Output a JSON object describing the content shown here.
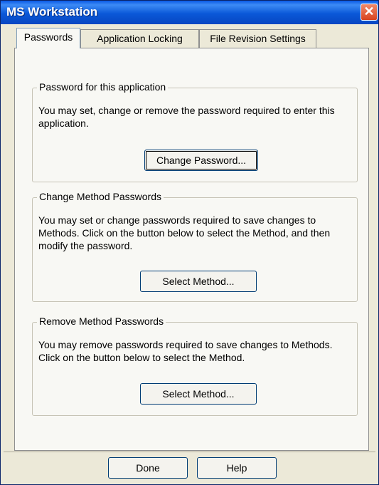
{
  "window": {
    "title": "MS Workstation"
  },
  "tabs": [
    {
      "label": "Passwords"
    },
    {
      "label": "Application Locking"
    },
    {
      "label": "File Revision Settings"
    }
  ],
  "groups": [
    {
      "title": "Password for this application",
      "text": "You may set, change or remove the password required to enter this application.",
      "button": "Change Password..."
    },
    {
      "title": "Change Method Passwords",
      "text": "You may set or change passwords required to save changes to Methods.  Click on the button below to select the Method, and then modify the password.",
      "button": "Select Method..."
    },
    {
      "title": "Remove Method Passwords",
      "text": "You may remove passwords required to save changes to Methods.  Click on the button below to select the Method.",
      "button": "Select Method..."
    }
  ],
  "footer": {
    "done_label": "Done",
    "help_label": "Help"
  },
  "colors": {
    "titlebar": "#0a58d8",
    "close": "#d8431f",
    "dialog_bg": "#ece9d8"
  },
  "icons": {
    "close": "close-icon"
  }
}
